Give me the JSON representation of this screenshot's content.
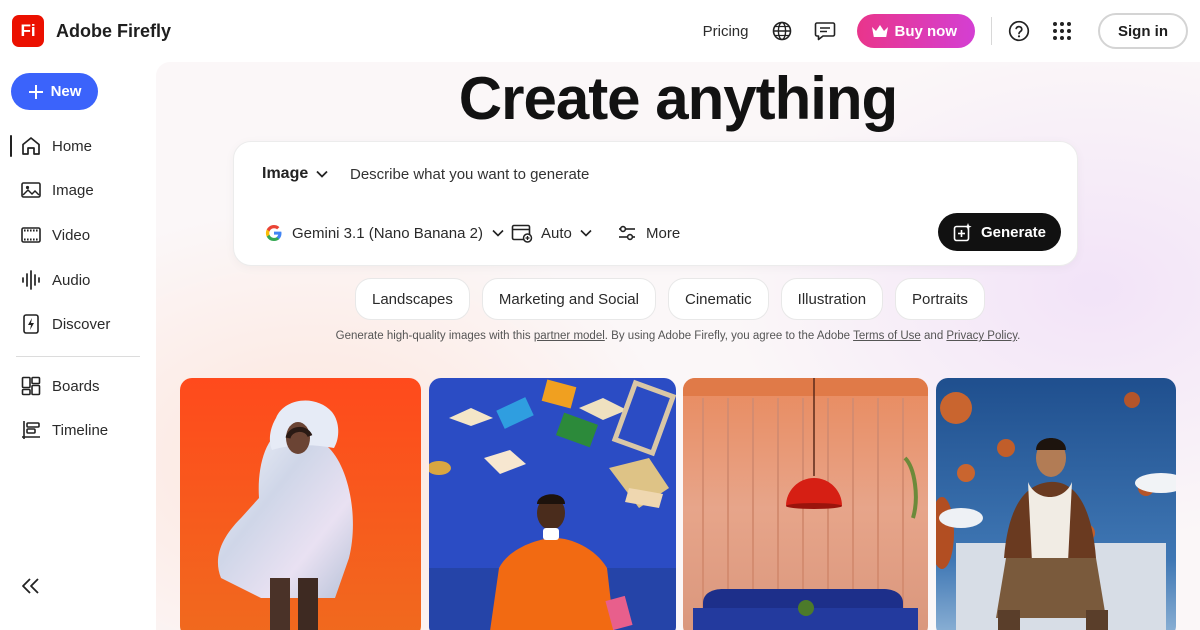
{
  "app": {
    "logo_text": "Fi",
    "name": "Adobe Firefly"
  },
  "topbar": {
    "pricing": "Pricing",
    "buy_now": "Buy now",
    "sign_in": "Sign in"
  },
  "sidebar": {
    "new_label": "New",
    "items": [
      {
        "label": "Home",
        "icon": "home-icon"
      },
      {
        "label": "Image",
        "icon": "image-icon"
      },
      {
        "label": "Video",
        "icon": "video-icon"
      },
      {
        "label": "Audio",
        "icon": "audio-icon"
      },
      {
        "label": "Discover",
        "icon": "discover-icon"
      },
      {
        "label": "Boards",
        "icon": "boards-icon"
      },
      {
        "label": "Timeline",
        "icon": "timeline-icon"
      }
    ],
    "active": "Home"
  },
  "main": {
    "headline": "Create anything",
    "prompt": {
      "mode": "Image",
      "placeholder": "Describe what you want to generate",
      "model": "Gemini 3.1 (Nano Banana 2)",
      "ratio": "Auto",
      "more": "More",
      "generate": "Generate"
    },
    "chips": [
      "Landscapes",
      "Marketing and Social",
      "Cinematic",
      "Illustration",
      "Portraits"
    ],
    "disclaimer": {
      "pre": "Generate high-quality images with this ",
      "link_model": "partner model",
      "mid": ".  By using Adobe Firefly, you agree to the Adobe ",
      "link_terms": "Terms of Use",
      "and": " and ",
      "link_privacy": "Privacy Policy",
      "post": "."
    },
    "gallery": [
      {
        "subject": "woman in iridescent puffer jacket on orange background"
      },
      {
        "subject": "man in orange coat with floating books on blue background"
      },
      {
        "subject": "red pendant lamp over blue sofa in peach room"
      },
      {
        "subject": "young man in varsity jacket with floating basketballs against sky"
      }
    ]
  },
  "colors": {
    "brand_red": "#eb1000",
    "new_button": "#3b63fb",
    "buy_now_gradient": [
      "#e9358b",
      "#d43fd3"
    ],
    "generate_button": "#111111"
  }
}
